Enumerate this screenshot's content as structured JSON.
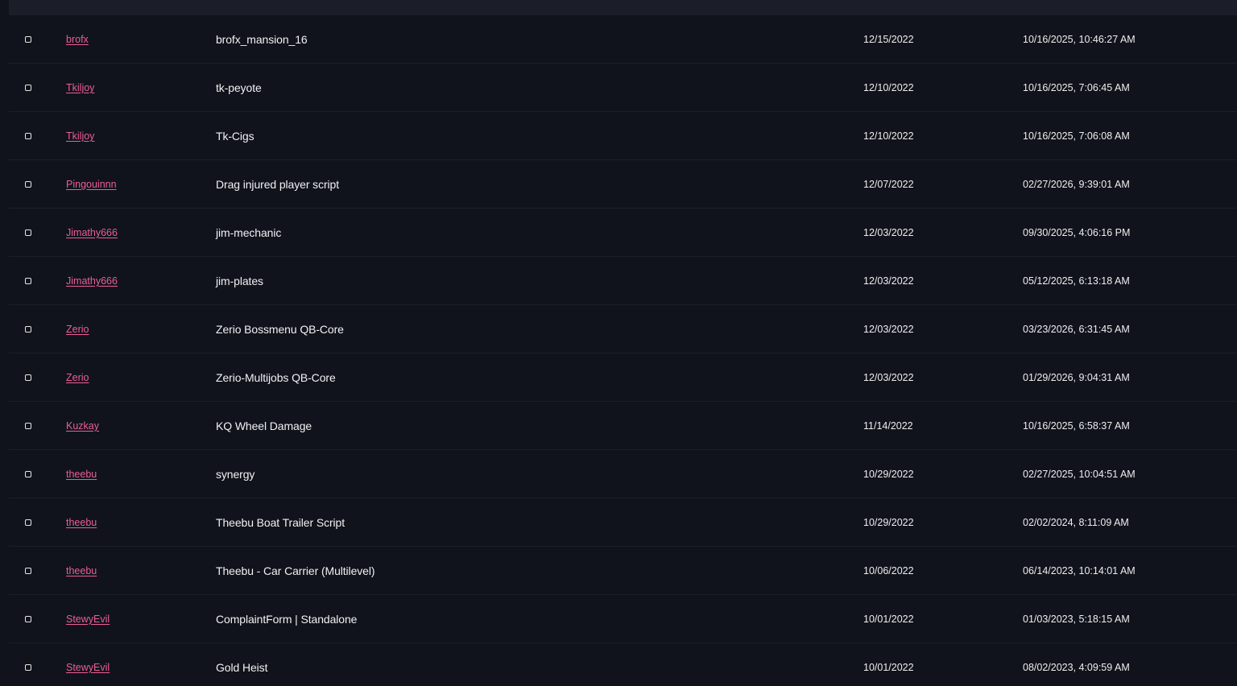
{
  "colors": {
    "background": "#10131b",
    "header": "#1b1e29",
    "author_link": "#ec5d9c",
    "text": "#f1f1f3",
    "divider": "#1c1f29"
  },
  "rows": [
    {
      "author": "brofx",
      "name": "brofx_mansion_16",
      "created": "12/15/2022",
      "updated": "10/16/2025, 10:46:27 AM"
    },
    {
      "author": "Tkiljoy",
      "name": "tk-peyote",
      "created": "12/10/2022",
      "updated": "10/16/2025, 7:06:45 AM"
    },
    {
      "author": "Tkiljoy",
      "name": "Tk-Cigs",
      "created": "12/10/2022",
      "updated": "10/16/2025, 7:06:08 AM"
    },
    {
      "author": "Pingouinnn",
      "name": "Drag injured player script",
      "created": "12/07/2022",
      "updated": "02/27/2026, 9:39:01 AM"
    },
    {
      "author": "Jimathy666",
      "name": "jim-mechanic",
      "created": "12/03/2022",
      "updated": "09/30/2025, 4:06:16 PM"
    },
    {
      "author": "Jimathy666",
      "name": "jim-plates",
      "created": "12/03/2022",
      "updated": "05/12/2025, 6:13:18 AM"
    },
    {
      "author": "Zerio",
      "name": "Zerio Bossmenu QB-Core",
      "created": "12/03/2022",
      "updated": "03/23/2026, 6:31:45 AM"
    },
    {
      "author": "Zerio",
      "name": "Zerio-Multijobs QB-Core",
      "created": "12/03/2022",
      "updated": "01/29/2026, 9:04:31 AM"
    },
    {
      "author": "Kuzkay",
      "name": "KQ Wheel Damage",
      "created": "11/14/2022",
      "updated": "10/16/2025, 6:58:37 AM"
    },
    {
      "author": "theebu",
      "name": "synergy",
      "created": "10/29/2022",
      "updated": "02/27/2025, 10:04:51 AM"
    },
    {
      "author": "theebu",
      "name": "Theebu Boat Trailer Script",
      "created": "10/29/2022",
      "updated": "02/02/2024, 8:11:09 AM"
    },
    {
      "author": "theebu",
      "name": "Theebu - Car Carrier (Multilevel)",
      "created": "10/06/2022",
      "updated": "06/14/2023, 10:14:01 AM"
    },
    {
      "author": "StewyEvil",
      "name": "ComplaintForm | Standalone",
      "created": "10/01/2022",
      "updated": "01/03/2023, 5:18:15 AM"
    },
    {
      "author": "StewyEvil",
      "name": "Gold Heist",
      "created": "10/01/2022",
      "updated": "08/02/2023, 4:09:59 AM"
    }
  ]
}
